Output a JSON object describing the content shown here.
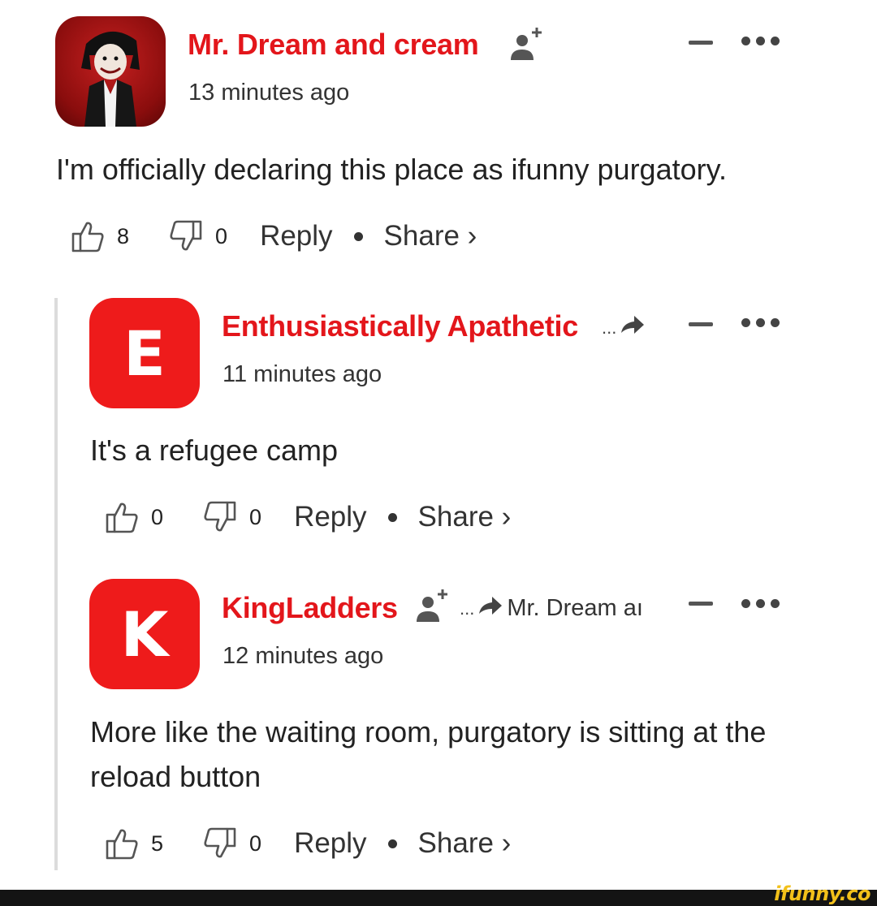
{
  "comments": [
    {
      "username": "Mr. Dream and cream",
      "timestamp": "13 minutes ago",
      "text": "I'm officially declaring this place as ifunny purgatory.",
      "likes": "8",
      "dislikes": "0",
      "reply_label": "Reply",
      "share_label": "Share ›",
      "avatar_type": "photo"
    },
    {
      "username": "Enthusiastically Apathetic",
      "avatar_letter": "E",
      "timestamp": "11 minutes ago",
      "text": "It's a refugee camp",
      "likes": "0",
      "dislikes": "0",
      "reply_label": "Reply",
      "share_label": "Share ›",
      "reply_to_ellipsis": "..."
    },
    {
      "username": "KingLadders",
      "avatar_letter": "K",
      "timestamp": "12 minutes ago",
      "text": "More like the waiting room, purgatory is sitting at the reload button",
      "likes": "5",
      "dislikes": "0",
      "reply_label": "Reply",
      "share_label": "Share ›",
      "reply_to_ellipsis": "...",
      "reply_to_name": "Mr. Dream aı"
    }
  ],
  "watermark": "ifunny.co",
  "colors": {
    "username": "#e3161b",
    "avatar_bg": "#ee1b1b",
    "text": "#222222",
    "icon": "#555555"
  },
  "icons": [
    "like-icon",
    "dislike-icon",
    "add-user-icon",
    "reply-arrow-icon",
    "minus-icon",
    "more-icon"
  ]
}
